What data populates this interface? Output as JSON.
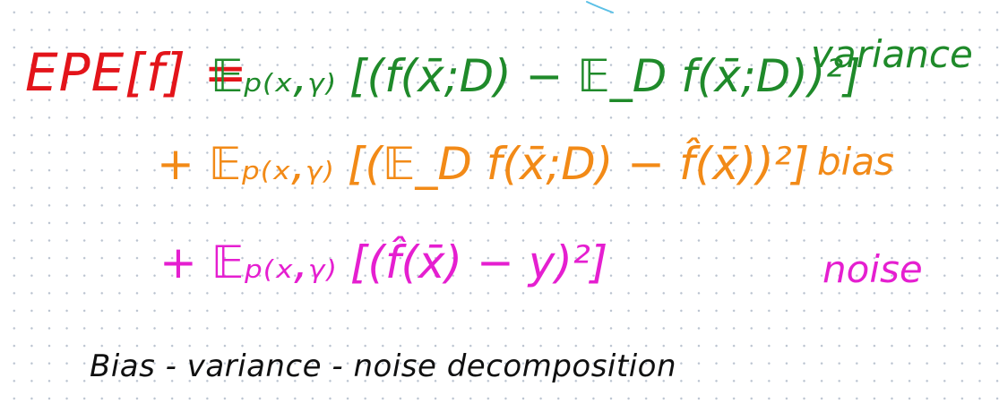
{
  "colors": {
    "lhs": "#e3141a",
    "variance": "#1f8a2a",
    "bias": "#f28a17",
    "noise": "#e51fd0",
    "caption": "#101010",
    "accent_stroke": "#5bc0e6",
    "dots": "#b9c2cf"
  },
  "equation": {
    "lhs": "EPE[f] =",
    "variance_term": "𝔼ₚ₍ₓ,ᵧ₎ [(f(x̄;D) − 𝔼_D f(x̄;D))²]",
    "bias_term": "+ 𝔼ₚ₍ₓ,ᵧ₎ [(𝔼_D f(x̄;D) − f̂(x̄))²]",
    "noise_term": "+ 𝔼ₚ₍ₓ,ᵧ₎ [(f̂(x̄) − y)²]"
  },
  "labels": {
    "variance": "variance",
    "bias": "bias",
    "noise": "noise"
  },
  "caption": "Bias - variance - noise decomposition"
}
